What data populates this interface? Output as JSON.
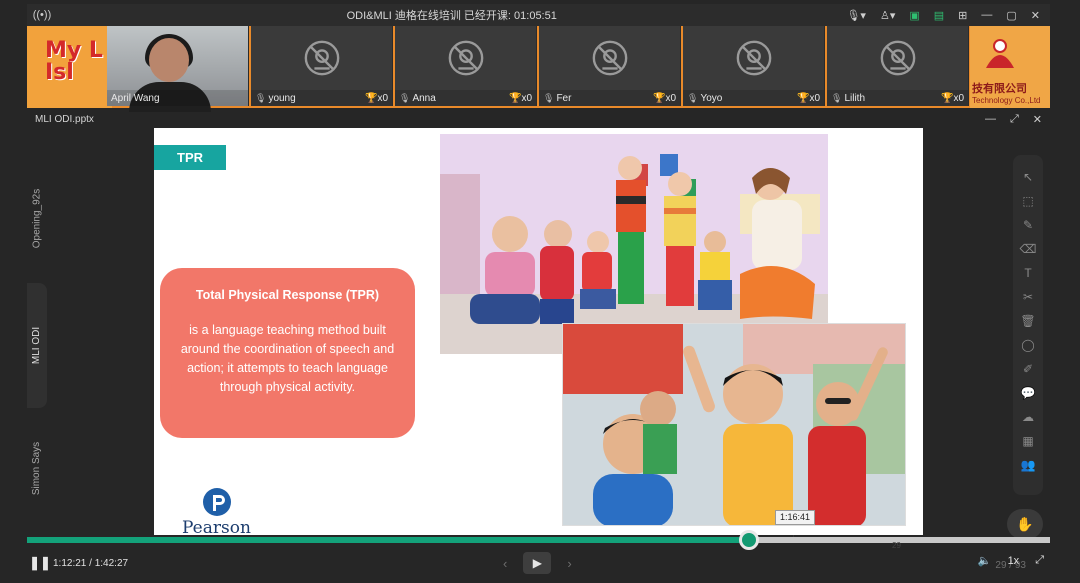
{
  "window": {
    "title": "ODI&MLI 迪格在线培训   已经开课: 01:05:51",
    "signal_icon": "broadcast-icon"
  },
  "banner": {
    "left_logo": "My L\nIsl",
    "right_company": "技有限公司",
    "right_company_en": "Technology Co.,Ltd"
  },
  "participants": [
    {
      "name": "April Wang",
      "camera": true
    },
    {
      "name": "young",
      "camera": false,
      "trophies": "x0"
    },
    {
      "name": "Anna",
      "camera": false,
      "trophies": "x0"
    },
    {
      "name": "Fer",
      "camera": false,
      "trophies": "x0"
    },
    {
      "name": "Yoyo",
      "camera": false,
      "trophies": "x0"
    },
    {
      "name": "Lilith",
      "camera": false,
      "trophies": "x0"
    }
  ],
  "document": {
    "filename": "MLI ODI.pptx"
  },
  "left_tabs": [
    "Opening_92s",
    "MLI ODI",
    "Simon Says"
  ],
  "slide": {
    "tag": "TPR",
    "callout_title": "Total Physical Response (TPR)",
    "callout_body": "is a language teaching method built around the coordination of speech and action; it attempts to teach language through physical activity.",
    "logo_text": "Pearson"
  },
  "player": {
    "current_time": "1:12:21",
    "separator": " / ",
    "total_time": "1:42:27",
    "hover_time": "1:16:41",
    "progress_fraction": 0.706,
    "slide_marker": "29",
    "speed": "1x",
    "page_indicator": "29 / 93"
  },
  "colors": {
    "accent_green": "#13a27a",
    "tag_teal": "#17a5a0",
    "callout_coral": "#f27769",
    "banner_orange": "#e98a2a"
  }
}
